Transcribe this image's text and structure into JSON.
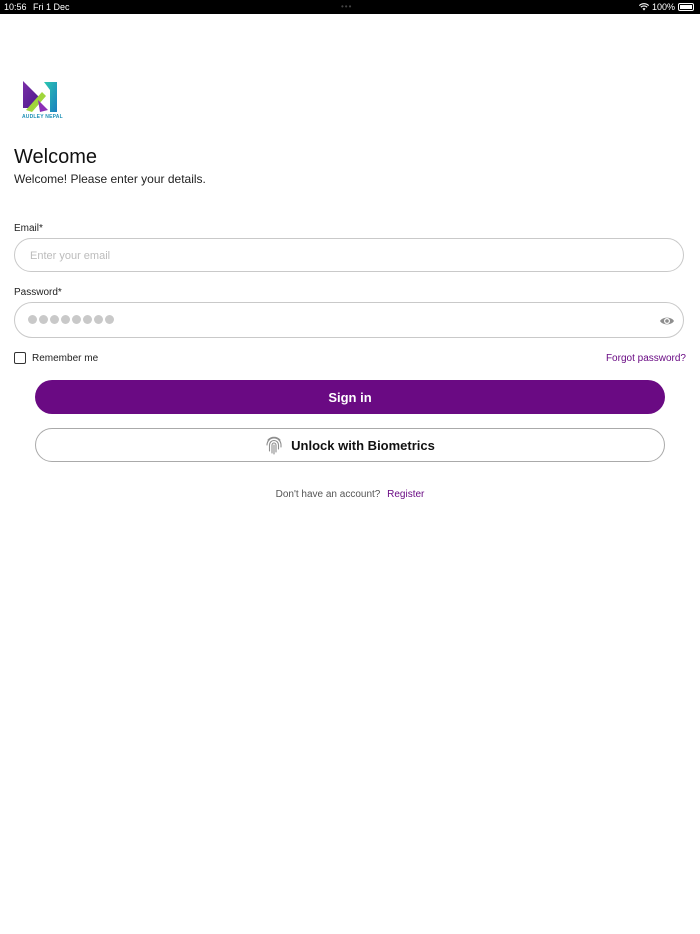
{
  "status_bar": {
    "time": "10:56",
    "date": "Fri 1 Dec",
    "battery": "100%"
  },
  "brand": {
    "logo_text": "AUDLEY NEPAL"
  },
  "header": {
    "title": "Welcome",
    "subtitle": "Welcome! Please enter your details."
  },
  "form": {
    "email_label": "Email*",
    "email_placeholder": "Enter your email",
    "email_value": "",
    "password_label": "Password*",
    "password_masked_length": 8,
    "remember_label": "Remember me",
    "remember_checked": false,
    "forgot_label": "Forgot password?"
  },
  "actions": {
    "signin_label": "Sign in",
    "biometrics_label": "Unlock with Biometrics"
  },
  "footer": {
    "prompt": "Don't have an account?",
    "register_label": "Register"
  },
  "icons": {
    "wifi": "wifi-icon",
    "battery": "battery-icon",
    "eye": "eye-icon",
    "fingerprint": "fingerprint-icon",
    "checkbox": "checkbox-icon"
  },
  "colors": {
    "accent": "#6a0a83",
    "field_border": "#c9c9c9",
    "link": "#6a0b84"
  }
}
